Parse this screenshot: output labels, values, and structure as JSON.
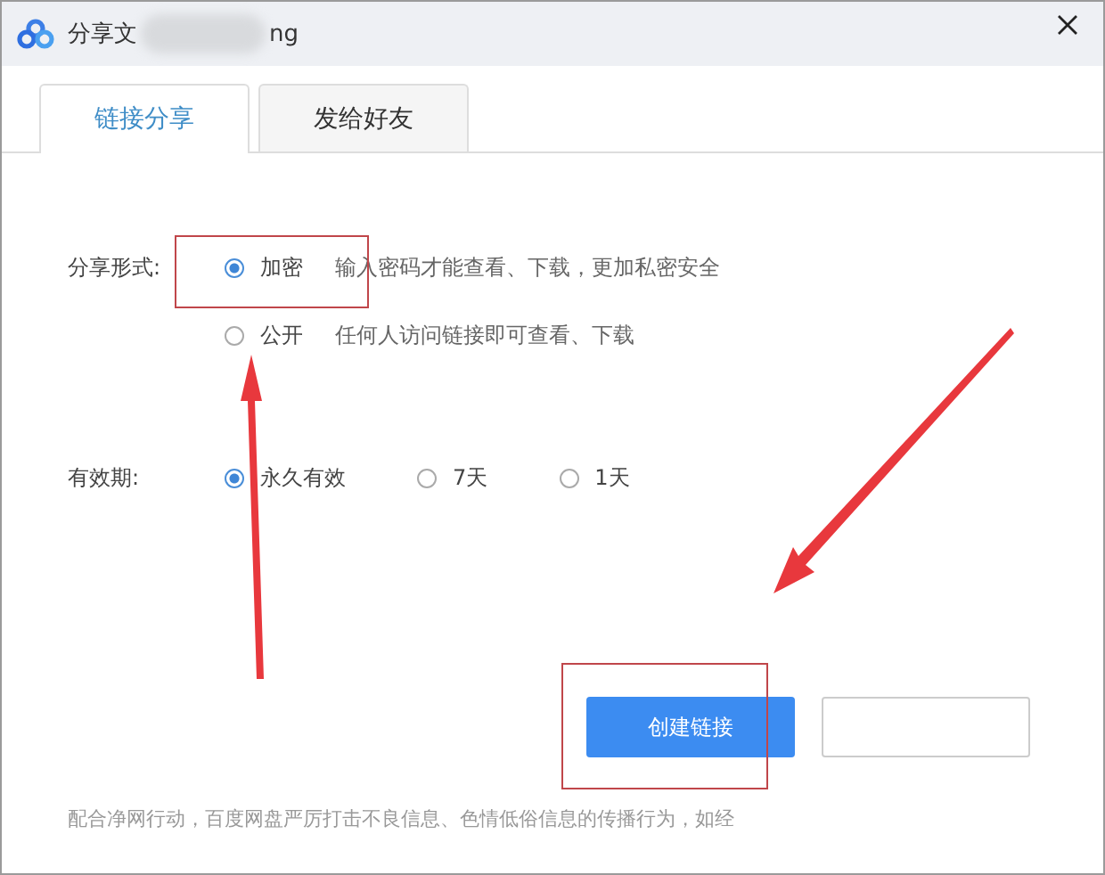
{
  "window": {
    "title": "分享文",
    "title_tail": "ng"
  },
  "tabs": [
    {
      "label": "链接分享",
      "selected": true
    },
    {
      "label": "发给好友",
      "selected": false
    }
  ],
  "share_form": {
    "label": "分享形式:",
    "options": [
      {
        "label": "加密",
        "description": "输入密码才能查看、下载，更加私密安全",
        "selected": true
      },
      {
        "label": "公开",
        "description": "任何人访问链接即可查看、下载",
        "selected": false
      }
    ]
  },
  "validity": {
    "label": "有效期:",
    "options": [
      {
        "label": "永久有效",
        "selected": true
      },
      {
        "label": "7天",
        "selected": false
      },
      {
        "label": "1天",
        "selected": false
      }
    ]
  },
  "buttons": [
    {
      "label": "创建链接",
      "kind": "primary"
    },
    {
      "kind": "secondary"
    }
  ],
  "footer": "配合净网行动，百度网盘严厉打击不良信息、色情低俗信息的传播行为，如经"
}
